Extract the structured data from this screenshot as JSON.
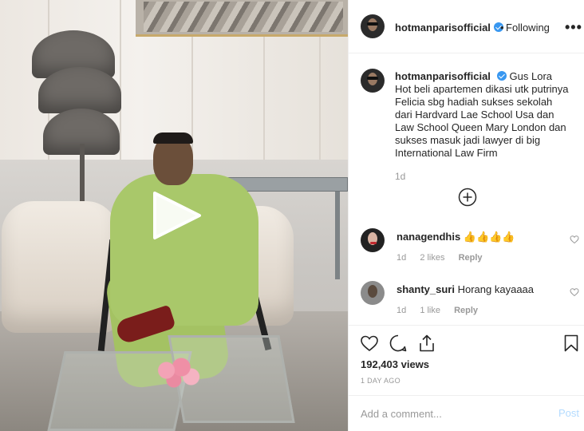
{
  "post": {
    "username": "hotmanparisofficial",
    "verified": true,
    "follow_status": "Following",
    "dot": "•",
    "more_label": "•••",
    "caption_user": "hotmanparisofficial",
    "caption_text": "Gus Lora Hot beli apartemen dikasi utk putrinya Felicia sbg hadiah sukses sekolah dari Hardvard Lae School Usa dan Law School Queen Mary London dan sukses masuk jadi lawyer di big International Law Firm",
    "caption_time": "1d"
  },
  "comments": [
    {
      "username": "nanagendhis",
      "text": "👍👍👍👍",
      "time": "1d",
      "likes": "2 likes",
      "reply": "Reply"
    },
    {
      "username": "shanty_suri",
      "text": "Horang kayaaaa",
      "time": "1d",
      "likes": "1 like",
      "reply": "Reply"
    }
  ],
  "stats": {
    "views": "192,403 views",
    "posted_ago": "1 DAY AGO"
  },
  "comment_box": {
    "placeholder": "Add a comment...",
    "post_label": "Post"
  },
  "colors": {
    "verified_badge": "#3897f0",
    "post_button_disabled": "#b3dbff",
    "secondary_text": "#999999"
  },
  "icons": [
    "play-icon",
    "verified-icon",
    "more-icon",
    "load-more-icon",
    "heart-icon",
    "comment-icon",
    "share-icon",
    "bookmark-icon"
  ]
}
